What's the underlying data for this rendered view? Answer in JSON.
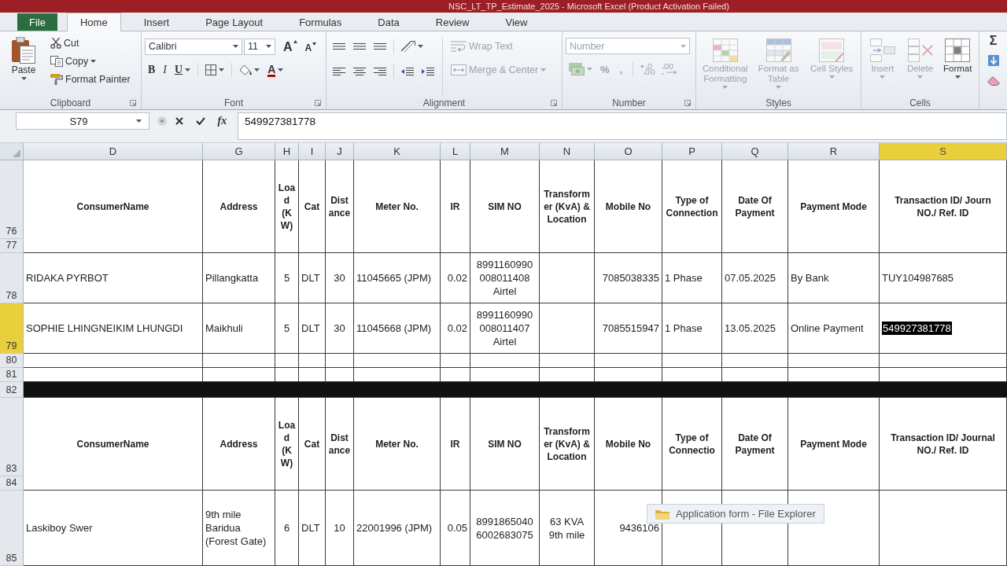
{
  "window": {
    "title": "NSC_LT_TP_Estimate_2025 - Microsoft Excel (Product Activation Failed)"
  },
  "tabs": [
    {
      "label": "File",
      "kind": "file",
      "selected": false
    },
    {
      "label": "Home",
      "kind": "tab",
      "selected": true
    },
    {
      "label": "Insert",
      "kind": "tab",
      "selected": false
    },
    {
      "label": "Page Layout",
      "kind": "tab",
      "selected": false
    },
    {
      "label": "Formulas",
      "kind": "tab",
      "selected": false
    },
    {
      "label": "Data",
      "kind": "tab",
      "selected": false
    },
    {
      "label": "Review",
      "kind": "tab",
      "selected": false
    },
    {
      "label": "View",
      "kind": "tab",
      "selected": false
    }
  ],
  "ribbon": {
    "clipboard": {
      "label": "Clipboard",
      "launcher": true,
      "paste": "Paste",
      "cut": "Cut",
      "copy": "Copy",
      "format_painter": "Format Painter"
    },
    "font": {
      "label": "Font",
      "launcher": true,
      "font_name": "Calibri",
      "font_size": "11",
      "grow": "A",
      "shrink": "A",
      "bold": "B",
      "italic": "I",
      "underline": "U",
      "font_color": "A"
    },
    "alignment": {
      "label": "Alignment",
      "launcher": true,
      "wrap_text": {
        "label": "Wrap Text",
        "disabled": true
      },
      "merge": {
        "label": "Merge & Center",
        "disabled": true
      }
    },
    "number": {
      "label": "Number",
      "launcher": true,
      "format": "Number",
      "percent": "%",
      "comma": ",",
      "disabled": true
    },
    "styles": {
      "label": "Styles",
      "buttons": [
        {
          "label": "Conditional Formatting",
          "kind": "conditional",
          "disabled": true
        },
        {
          "label": "Format as Table",
          "kind": "table",
          "disabled": true
        },
        {
          "label": "Cell Styles",
          "kind": "cell_styles",
          "disabled": true
        }
      ]
    },
    "cells": {
      "label": "Cells",
      "buttons": [
        {
          "label": "Insert",
          "kind": "insert",
          "disabled": true
        },
        {
          "label": "Delete",
          "kind": "delete",
          "disabled": true
        },
        {
          "label": "Format",
          "kind": "format",
          "disabled": false
        }
      ]
    },
    "editing": {
      "autosum": "Σ"
    }
  },
  "formula_bar": {
    "name_box": "S79",
    "function": "fx",
    "value": "549927381778"
  },
  "sheet": {
    "columns": [
      {
        "letter": "D",
        "selected": false
      },
      {
        "letter": "G",
        "selected": false
      },
      {
        "letter": "H",
        "selected": false
      },
      {
        "letter": "I",
        "selected": false
      },
      {
        "letter": "J",
        "selected": false
      },
      {
        "letter": "K",
        "selected": false
      },
      {
        "letter": "L",
        "selected": false
      },
      {
        "letter": "M",
        "selected": false
      },
      {
        "letter": "N",
        "selected": false
      },
      {
        "letter": "O",
        "selected": false
      },
      {
        "letter": "P",
        "selected": false
      },
      {
        "letter": "Q",
        "selected": false
      },
      {
        "letter": "R",
        "selected": false
      },
      {
        "letter": "S",
        "selected": true
      }
    ],
    "blocks": [
      {
        "kind": "header",
        "rows": [
          {
            "label": "76",
            "selected": false
          },
          {
            "label": "77",
            "selected": false
          }
        ],
        "cells": [
          "ConsumerName",
          "Address",
          "Load (KW)",
          "Cat",
          "Distance",
          "Meter No.",
          "IR",
          "SIM NO",
          "Transformer (KvA) & Location",
          "Mobile No",
          "Type of Connection",
          "Date Of Payment",
          "Payment Mode",
          "Transaction ID/ Journ NO./ Ref. ID"
        ]
      },
      {
        "kind": "data",
        "rows": [
          {
            "label": "78",
            "selected": false
          }
        ],
        "cells": [
          "RIDAKA PYRBOT",
          "Pillangkatta",
          "5",
          "DLT",
          "30",
          "11045665 (JPM)",
          "0.02",
          "8991160990 008011408 Airtel",
          null,
          "7085038335",
          "1 Phase",
          "07.05.2025",
          "By Bank",
          "TUY104987685"
        ]
      },
      {
        "kind": "data",
        "rows": [
          {
            "label": "79",
            "selected": true
          }
        ],
        "cells": [
          "SOPHIE LHINGNEIKIM LHUNGDI",
          "Maikhuli",
          "5",
          "DLT",
          "30",
          "11045668 (JPM)",
          "0.02",
          "8991160990 008011407 Airtel",
          null,
          "7085515947",
          "1 Phase",
          "13.05.2025",
          "Online Payment",
          "549927381778"
        ]
      },
      {
        "kind": "empty",
        "rows": [
          {
            "label": "80",
            "selected": false
          }
        ]
      },
      {
        "kind": "empty",
        "rows": [
          {
            "label": "81",
            "selected": false
          }
        ]
      },
      {
        "kind": "filled",
        "rows": [
          {
            "label": "82",
            "selected": false
          }
        ]
      },
      {
        "kind": "header",
        "rows": [
          {
            "label": "83",
            "selected": false
          },
          {
            "label": "84",
            "selected": false
          }
        ],
        "cells": [
          "ConsumerName",
          "Address",
          "Load (KW)",
          "Cat",
          "Distance",
          "Meter No.",
          "IR",
          "SIM NO",
          "Transformer (KvA) & Location",
          "Mobile No",
          "Type of Connectio",
          "Date Of Payment",
          "Payment Mode",
          "Transaction ID/ Journal NO./ Ref. ID"
        ]
      },
      {
        "kind": "data",
        "rows": [
          {
            "label": "85",
            "selected": false
          }
        ],
        "cells": [
          "Laskiboy Swer",
          "9th mile Baridua (Forest Gate)",
          "6",
          "DLT",
          "10",
          "22001996 (JPM)",
          "0.05",
          "8991865040 6002683075",
          "63 KVA 9th mile",
          "9436106",
          null,
          null,
          null,
          null
        ]
      }
    ]
  },
  "preview": {
    "title": "Application form - File Explorer"
  }
}
